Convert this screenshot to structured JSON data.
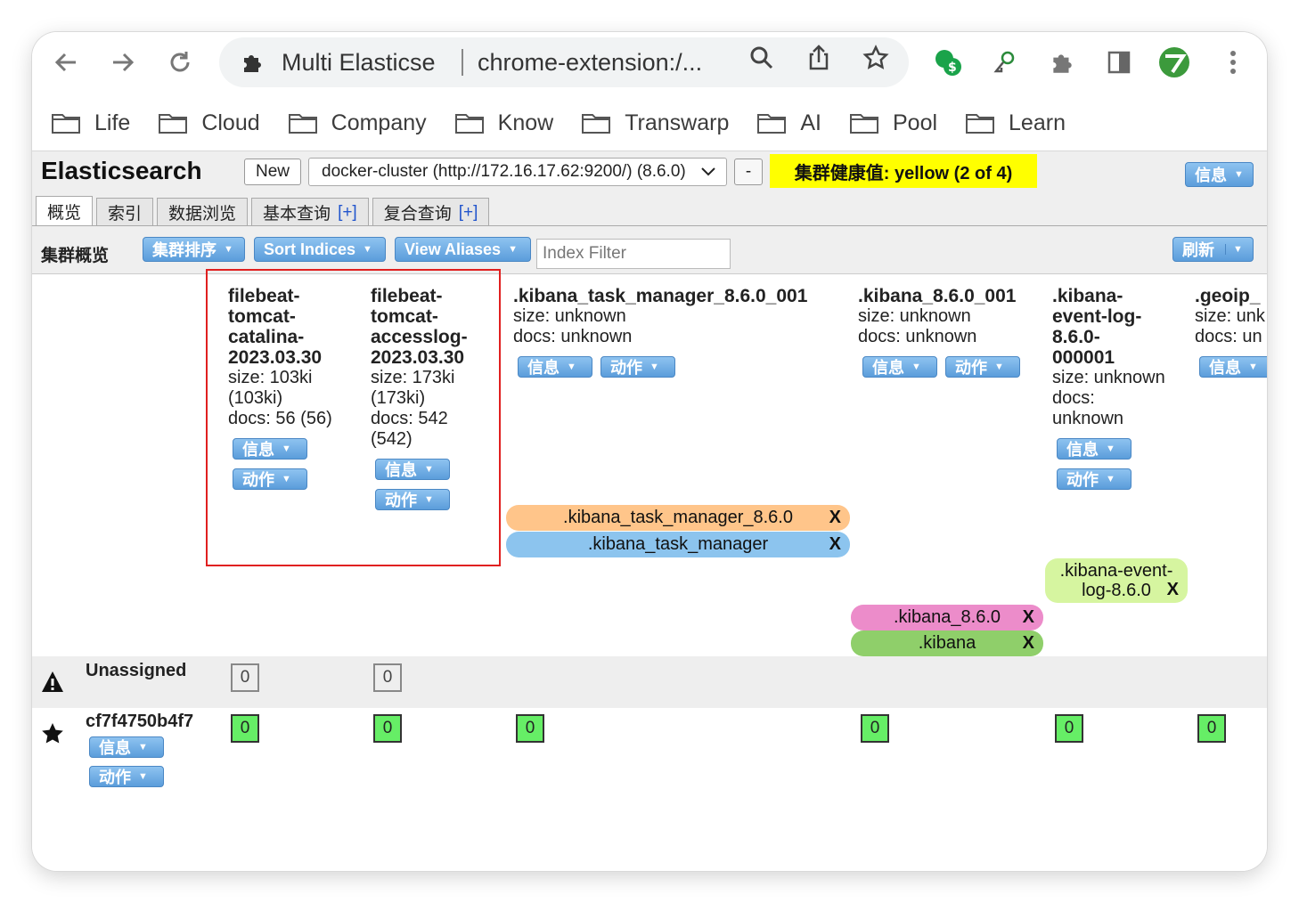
{
  "browser": {
    "tab_title": "Multi Elasticse",
    "url": "chrome-extension:/...",
    "bookmarks": [
      "Life",
      "Cloud",
      "Company",
      "Know",
      "Transwarp",
      "AI",
      "Pool",
      "Learn"
    ]
  },
  "app": {
    "logo": "Elasticsearch",
    "new_label": "New",
    "cluster_value": "docker-cluster (http://172.16.17.62:9200/) (8.6.0)",
    "minus_label": "-",
    "health_text": "集群健康值: yellow (2 of 4)",
    "info_label": "信息",
    "tabs": [
      {
        "label": "概览",
        "plus": ""
      },
      {
        "label": "索引",
        "plus": ""
      },
      {
        "label": "数据浏览",
        "plus": ""
      },
      {
        "label": "基本查询",
        "plus": "[+]"
      },
      {
        "label": "复合查询",
        "plus": "[+]"
      }
    ],
    "overview_label": "集群概览",
    "sort_cluster_label": "集群排序",
    "sort_indices_label": "Sort Indices",
    "view_aliases_label": "View Aliases",
    "index_filter_placeholder": "Index Filter",
    "refresh_label": "刷新"
  },
  "indices": [
    {
      "name": "filebeat-tomcat-catalina-2023.03.30",
      "lines": [
        "size: 103ki",
        "(103ki)",
        "docs: 56 (56)"
      ]
    },
    {
      "name": "filebeat-tomcat-accesslog-2023.03.30",
      "lines": [
        "size: 173ki",
        "(173ki)",
        "docs: 542",
        "(542)"
      ]
    },
    {
      "name": ".kibana_task_manager_8.6.0_001",
      "lines": [
        "size: unknown",
        "docs: unknown"
      ]
    },
    {
      "name": ".kibana_8.6.0_001",
      "lines": [
        "size: unknown",
        "docs: unknown"
      ]
    },
    {
      "name": ".kibana-event-log-8.6.0-000001",
      "lines": [
        "size: unknown",
        "docs:",
        "unknown"
      ]
    },
    {
      "name": ".geoip_",
      "lines": [
        "size: unk",
        "docs: un"
      ]
    }
  ],
  "buttons": {
    "info": "信息",
    "action": "动作"
  },
  "aliases": [
    {
      "label": ".kibana_task_manager_8.6.0",
      "color": "#ffc58a",
      "close": "X"
    },
    {
      "label": ".kibana_task_manager",
      "color": "#8cc4ee",
      "close": "X"
    },
    {
      "label": ".kibana-event-log-8.6.0",
      "color": "#d6f5a0",
      "close": "X"
    },
    {
      "label": ".kibana_8.6.0",
      "color": "#ec8cca",
      "close": "X"
    },
    {
      "label": ".kibana",
      "color": "#8fcf6a",
      "close": "X"
    }
  ],
  "rows": {
    "unassigned_label": "Unassigned",
    "unassigned_shards": [
      "0",
      "0"
    ],
    "node_label": "cf7f4750b4f7",
    "node_shards": [
      "0",
      "0",
      "0",
      "0",
      "0",
      "0"
    ]
  }
}
